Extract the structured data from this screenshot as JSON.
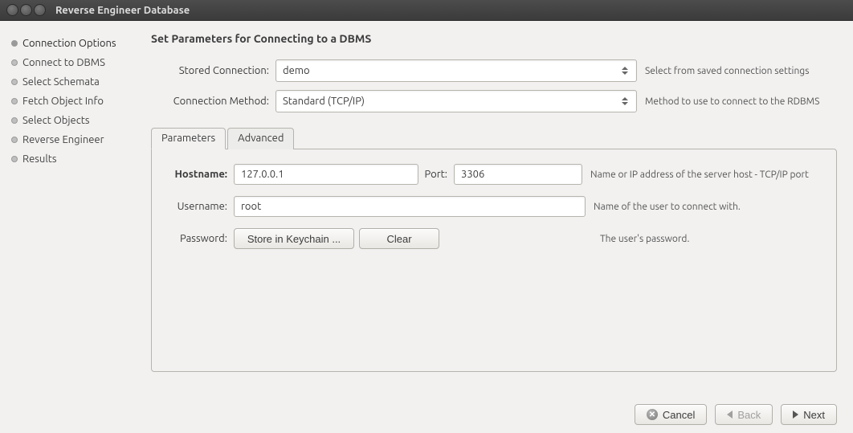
{
  "window": {
    "title": "Reverse Engineer Database"
  },
  "sidebar": {
    "steps": [
      {
        "label": "Connection Options",
        "active": true
      },
      {
        "label": "Connect to DBMS",
        "active": false
      },
      {
        "label": "Select Schemata",
        "active": false
      },
      {
        "label": "Fetch Object Info",
        "active": false
      },
      {
        "label": "Select Objects",
        "active": false
      },
      {
        "label": "Reverse Engineer",
        "active": false
      },
      {
        "label": "Results",
        "active": false
      }
    ]
  },
  "main": {
    "heading": "Set Parameters for Connecting to a DBMS",
    "stored_connection": {
      "label": "Stored Connection:",
      "value": "demo",
      "hint": "Select from saved connection settings"
    },
    "connection_method": {
      "label": "Connection Method:",
      "value": "Standard (TCP/IP)",
      "hint": "Method to use to connect to the RDBMS"
    },
    "tabs": {
      "parameters": "Parameters",
      "advanced": "Advanced"
    },
    "params": {
      "hostname": {
        "label": "Hostname:",
        "value": "127.0.0.1"
      },
      "port": {
        "label": "Port:",
        "value": "3306"
      },
      "hostname_hint": "Name or IP address of the server host - TCP/IP port",
      "username": {
        "label": "Username:",
        "value": "root",
        "hint": "Name of the user to connect with."
      },
      "password": {
        "label": "Password:",
        "store_btn": "Store in Keychain ...",
        "clear_btn": "Clear",
        "hint": "The user's password."
      }
    }
  },
  "footer": {
    "cancel": "Cancel",
    "back": "Back",
    "next": "Next"
  }
}
